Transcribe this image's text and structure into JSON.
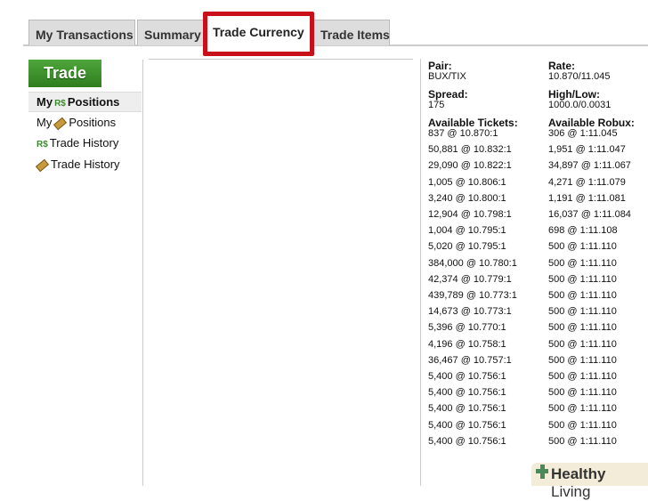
{
  "tabs": [
    "My Transactions",
    "Summary",
    "Trade Currency",
    "Trade Items"
  ],
  "trade_button": "Trade",
  "nav": {
    "my": "My",
    "positions": "Positions",
    "trade_history": "Trade History",
    "rs": "R$"
  },
  "info": {
    "pair_label": "Pair:",
    "pair": "BUX/TIX",
    "rate_label": "Rate:",
    "rate": "10.870/11.045",
    "spread_label": "Spread:",
    "spread": "175",
    "highlow_label": "High/Low:",
    "highlow": "1000.0/0.0031",
    "tickets_label": "Available Tickets:",
    "robux_label": "Available Robux:"
  },
  "tickets": [
    "837 @ 10.870:1",
    "50,881 @ 10.832:1",
    "29,090 @ 10.822:1",
    "1,005 @ 10.806:1",
    "3,240 @ 10.800:1",
    "12,904 @ 10.798:1",
    "1,004 @ 10.795:1",
    "5,020 @ 10.795:1",
    "384,000 @ 10.780:1",
    "42,374 @ 10.779:1",
    "439,789 @ 10.773:1",
    "14,673 @ 10.773:1",
    "5,396 @ 10.770:1",
    "4,196 @ 10.758:1",
    "36,467 @ 10.757:1",
    "5,400 @ 10.756:1",
    "5,400 @ 10.756:1",
    "5,400 @ 10.756:1",
    "5,400 @ 10.756:1",
    "5,400 @ 10.756:1"
  ],
  "robux": [
    "306 @ 1:11.045",
    "1,951 @ 1:11.047",
    "34,897 @ 1:11.067",
    "4,271 @ 1:11.079",
    "1,191 @ 1:11.081",
    "16,037 @ 1:11.084",
    "698 @ 1:11.108",
    "500 @ 1:11.110",
    "500 @ 1:11.110",
    "500 @ 1:11.110",
    "500 @ 1:11.110",
    "500 @ 1:11.110",
    "500 @ 1:11.110",
    "500 @ 1:11.110",
    "500 @ 1:11.110",
    "500 @ 1:11.110",
    "500 @ 1:11.110",
    "500 @ 1:11.110",
    "500 @ 1:11.110",
    "500 @ 1:11.110"
  ],
  "watermark": {
    "bold": "Healthy",
    "normal": "Living"
  }
}
